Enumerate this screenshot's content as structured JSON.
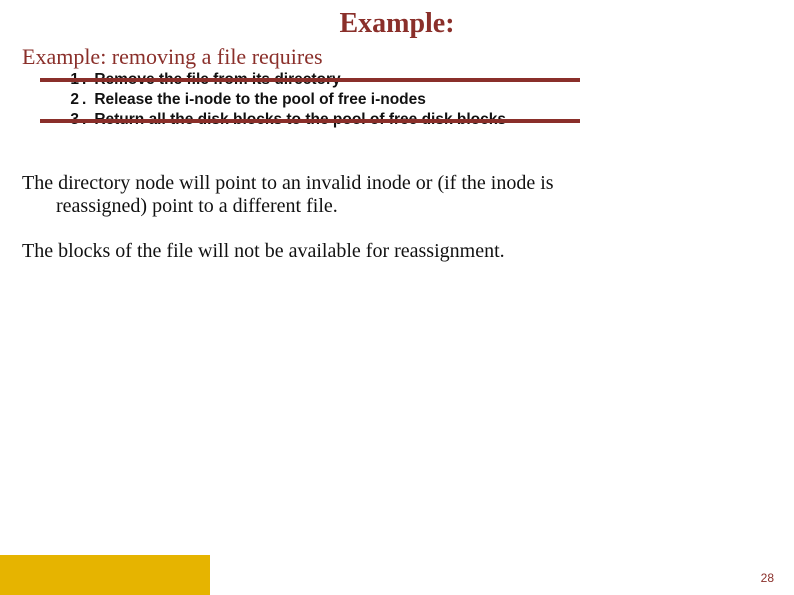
{
  "title": "Example:",
  "subtitle": "Example: removing a file requires",
  "list": [
    {
      "n": "1",
      "text": "Remove the file from its directory"
    },
    {
      "n": "2",
      "text": "Release the i-node to the pool of free i-nodes"
    },
    {
      "n": "3",
      "text": "Return all the disk blocks to the pool of free disk blocks"
    }
  ],
  "body1_a": "The directory node will point to an invalid inode or (if the inode is",
  "body1_b": "reassigned) point to a different file.",
  "body2": "The blocks of the file will not be available for  reassignment.",
  "page": "28"
}
